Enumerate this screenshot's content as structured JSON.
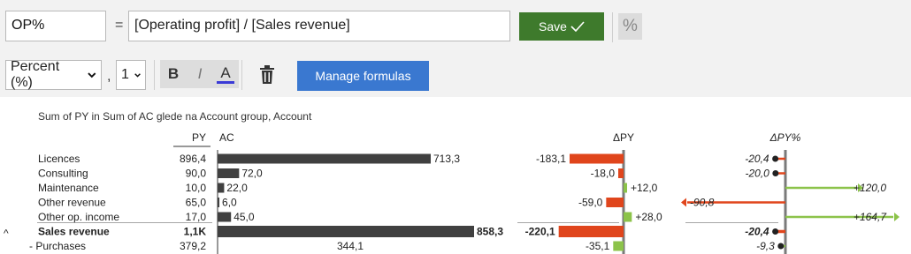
{
  "toolbar": {
    "name_value": "OP%",
    "equals": "=",
    "formula_value": "[Operating profit] / [Sales revenue]",
    "save_label": "Save",
    "percent_toggle": "%",
    "format_select": "Percent (%)",
    "decimal_separator": ",",
    "decimals_select": "1",
    "bold_label": "B",
    "italic_label": "I",
    "color_label": "A",
    "manage_label": "Manage formulas"
  },
  "chart_data": {
    "type": "table",
    "title": "Sum of PY in Sum of AC glede na Account group, Account",
    "columns": {
      "py": "PY",
      "ac": "AC",
      "dpy": "ΔPY",
      "dpypct": "ΔPY%"
    },
    "rows": [
      {
        "label": "Licences",
        "py": "896,4",
        "ac": 713.3,
        "ac_label": "713,3",
        "dpy": -183.1,
        "dpy_label": "-183,1",
        "dpypct": -20.4,
        "dpypct_label": "-20,4"
      },
      {
        "label": "Consulting",
        "py": "90,0",
        "ac": 72.0,
        "ac_label": "72,0",
        "dpy": -18.0,
        "dpy_label": "-18,0",
        "dpypct": -20.0,
        "dpypct_label": "-20,0"
      },
      {
        "label": "Maintenance",
        "py": "10,0",
        "ac": 22.0,
        "ac_label": "22,0",
        "dpy": 12.0,
        "dpy_label": "+12,0",
        "dpypct": 120.0,
        "dpypct_label": "+120,0"
      },
      {
        "label": "Other revenue",
        "py": "65,0",
        "ac": 6.0,
        "ac_label": "6,0",
        "dpy": -59.0,
        "dpy_label": "-59,0",
        "dpypct": -90.8,
        "dpypct_label": "-90,8"
      },
      {
        "label": "Other op. income",
        "py": "17,0",
        "ac": 45.0,
        "ac_label": "45,0",
        "dpy": 28.0,
        "dpy_label": "+28,0",
        "dpypct": 164.7,
        "dpypct_label": "+164,7"
      },
      {
        "label": "Sales revenue",
        "py": "1,1K",
        "ac": 858.3,
        "ac_label": "858,3",
        "dpy": -220.1,
        "dpy_label": "-220,1",
        "dpypct": -20.4,
        "dpypct_label": "-20,4",
        "bold": true,
        "prefix": ""
      },
      {
        "label": "Purchases",
        "py": "379,2",
        "ac": 344.1,
        "ac_label": "344,1",
        "dpy": -35.1,
        "dpy_label": "-35,1",
        "dpypct": -9.3,
        "dpypct_label": "-9,3",
        "prefix": "- ",
        "cost": true
      }
    ],
    "colors": {
      "ac_bar": "#404040",
      "negative": "#e0451c",
      "positive": "#8cc34a",
      "axis": "#7a7a7a"
    }
  }
}
